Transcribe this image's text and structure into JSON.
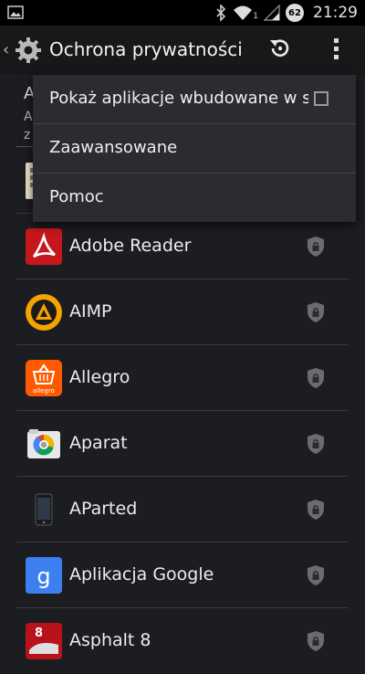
{
  "status_bar": {
    "time": "21:29",
    "battery": "62",
    "signal_label": "1"
  },
  "action_bar": {
    "title": "Ochrona prywatności"
  },
  "background_header": {
    "first_letter": "A",
    "sub_line1": "A",
    "sub_line2": "z"
  },
  "overflow_menu": {
    "items": [
      {
        "label": "Pokaż aplikacje wbudowane w s",
        "checkbox": false
      },
      {
        "label": "Zaawansowane"
      },
      {
        "label": "Pomoc"
      }
    ]
  },
  "apps": [
    {
      "name": "",
      "icon": "keyboard-app-icon"
    },
    {
      "name": "Adobe Reader",
      "icon": "adobe-reader-icon"
    },
    {
      "name": "AIMP",
      "icon": "aimp-icon"
    },
    {
      "name": "Allegro",
      "icon": "allegro-icon"
    },
    {
      "name": "Aparat",
      "icon": "camera-app-icon"
    },
    {
      "name": "APārted",
      "icon": "phone-icon"
    },
    {
      "name": "Aplikacja Google",
      "icon": "google-icon"
    },
    {
      "name": "Asphalt 8",
      "icon": "asphalt-icon"
    }
  ],
  "colors": {
    "adobe": "#c8161d",
    "aimp": "#f5a300",
    "allegro": "#ff5a00",
    "google": "#3c7ff0"
  }
}
